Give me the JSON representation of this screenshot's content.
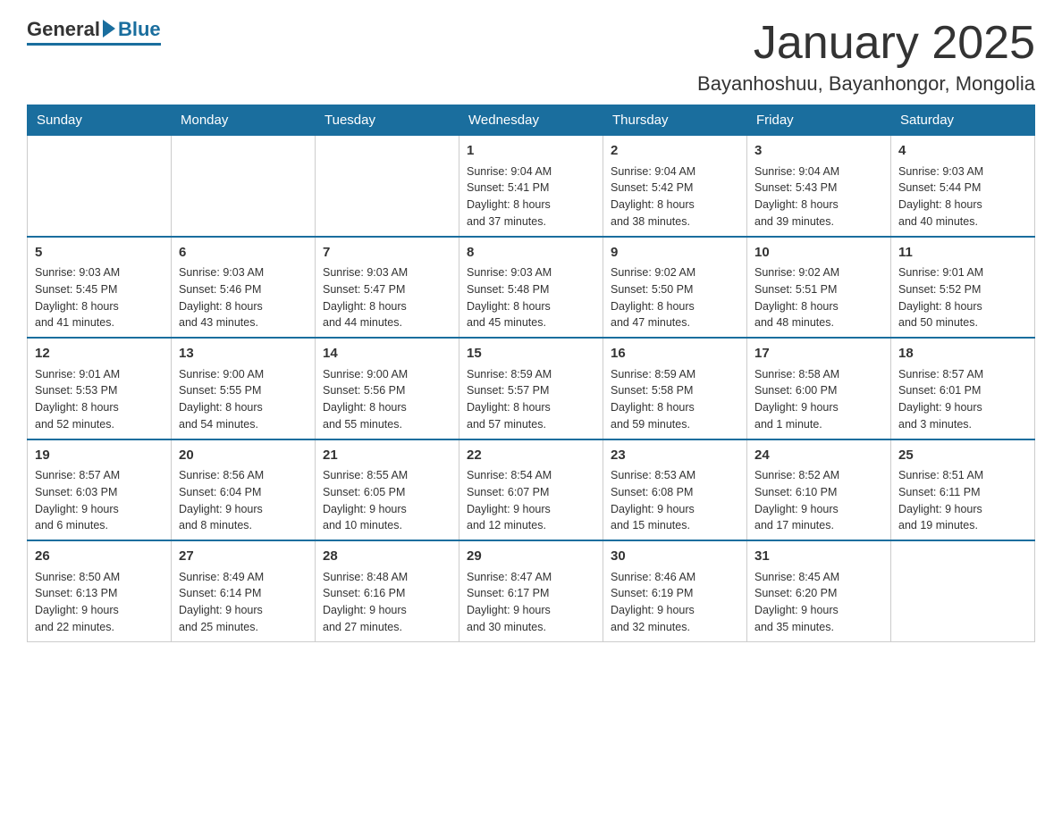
{
  "logo": {
    "general": "General",
    "blue": "Blue"
  },
  "title": "January 2025",
  "location": "Bayanhoshuu, Bayanhongor, Mongolia",
  "days_of_week": [
    "Sunday",
    "Monday",
    "Tuesday",
    "Wednesday",
    "Thursday",
    "Friday",
    "Saturday"
  ],
  "weeks": [
    [
      {
        "day": "",
        "info": ""
      },
      {
        "day": "",
        "info": ""
      },
      {
        "day": "",
        "info": ""
      },
      {
        "day": "1",
        "info": "Sunrise: 9:04 AM\nSunset: 5:41 PM\nDaylight: 8 hours\nand 37 minutes."
      },
      {
        "day": "2",
        "info": "Sunrise: 9:04 AM\nSunset: 5:42 PM\nDaylight: 8 hours\nand 38 minutes."
      },
      {
        "day": "3",
        "info": "Sunrise: 9:04 AM\nSunset: 5:43 PM\nDaylight: 8 hours\nand 39 minutes."
      },
      {
        "day": "4",
        "info": "Sunrise: 9:03 AM\nSunset: 5:44 PM\nDaylight: 8 hours\nand 40 minutes."
      }
    ],
    [
      {
        "day": "5",
        "info": "Sunrise: 9:03 AM\nSunset: 5:45 PM\nDaylight: 8 hours\nand 41 minutes."
      },
      {
        "day": "6",
        "info": "Sunrise: 9:03 AM\nSunset: 5:46 PM\nDaylight: 8 hours\nand 43 minutes."
      },
      {
        "day": "7",
        "info": "Sunrise: 9:03 AM\nSunset: 5:47 PM\nDaylight: 8 hours\nand 44 minutes."
      },
      {
        "day": "8",
        "info": "Sunrise: 9:03 AM\nSunset: 5:48 PM\nDaylight: 8 hours\nand 45 minutes."
      },
      {
        "day": "9",
        "info": "Sunrise: 9:02 AM\nSunset: 5:50 PM\nDaylight: 8 hours\nand 47 minutes."
      },
      {
        "day": "10",
        "info": "Sunrise: 9:02 AM\nSunset: 5:51 PM\nDaylight: 8 hours\nand 48 minutes."
      },
      {
        "day": "11",
        "info": "Sunrise: 9:01 AM\nSunset: 5:52 PM\nDaylight: 8 hours\nand 50 minutes."
      }
    ],
    [
      {
        "day": "12",
        "info": "Sunrise: 9:01 AM\nSunset: 5:53 PM\nDaylight: 8 hours\nand 52 minutes."
      },
      {
        "day": "13",
        "info": "Sunrise: 9:00 AM\nSunset: 5:55 PM\nDaylight: 8 hours\nand 54 minutes."
      },
      {
        "day": "14",
        "info": "Sunrise: 9:00 AM\nSunset: 5:56 PM\nDaylight: 8 hours\nand 55 minutes."
      },
      {
        "day": "15",
        "info": "Sunrise: 8:59 AM\nSunset: 5:57 PM\nDaylight: 8 hours\nand 57 minutes."
      },
      {
        "day": "16",
        "info": "Sunrise: 8:59 AM\nSunset: 5:58 PM\nDaylight: 8 hours\nand 59 minutes."
      },
      {
        "day": "17",
        "info": "Sunrise: 8:58 AM\nSunset: 6:00 PM\nDaylight: 9 hours\nand 1 minute."
      },
      {
        "day": "18",
        "info": "Sunrise: 8:57 AM\nSunset: 6:01 PM\nDaylight: 9 hours\nand 3 minutes."
      }
    ],
    [
      {
        "day": "19",
        "info": "Sunrise: 8:57 AM\nSunset: 6:03 PM\nDaylight: 9 hours\nand 6 minutes."
      },
      {
        "day": "20",
        "info": "Sunrise: 8:56 AM\nSunset: 6:04 PM\nDaylight: 9 hours\nand 8 minutes."
      },
      {
        "day": "21",
        "info": "Sunrise: 8:55 AM\nSunset: 6:05 PM\nDaylight: 9 hours\nand 10 minutes."
      },
      {
        "day": "22",
        "info": "Sunrise: 8:54 AM\nSunset: 6:07 PM\nDaylight: 9 hours\nand 12 minutes."
      },
      {
        "day": "23",
        "info": "Sunrise: 8:53 AM\nSunset: 6:08 PM\nDaylight: 9 hours\nand 15 minutes."
      },
      {
        "day": "24",
        "info": "Sunrise: 8:52 AM\nSunset: 6:10 PM\nDaylight: 9 hours\nand 17 minutes."
      },
      {
        "day": "25",
        "info": "Sunrise: 8:51 AM\nSunset: 6:11 PM\nDaylight: 9 hours\nand 19 minutes."
      }
    ],
    [
      {
        "day": "26",
        "info": "Sunrise: 8:50 AM\nSunset: 6:13 PM\nDaylight: 9 hours\nand 22 minutes."
      },
      {
        "day": "27",
        "info": "Sunrise: 8:49 AM\nSunset: 6:14 PM\nDaylight: 9 hours\nand 25 minutes."
      },
      {
        "day": "28",
        "info": "Sunrise: 8:48 AM\nSunset: 6:16 PM\nDaylight: 9 hours\nand 27 minutes."
      },
      {
        "day": "29",
        "info": "Sunrise: 8:47 AM\nSunset: 6:17 PM\nDaylight: 9 hours\nand 30 minutes."
      },
      {
        "day": "30",
        "info": "Sunrise: 8:46 AM\nSunset: 6:19 PM\nDaylight: 9 hours\nand 32 minutes."
      },
      {
        "day": "31",
        "info": "Sunrise: 8:45 AM\nSunset: 6:20 PM\nDaylight: 9 hours\nand 35 minutes."
      },
      {
        "day": "",
        "info": ""
      }
    ]
  ]
}
